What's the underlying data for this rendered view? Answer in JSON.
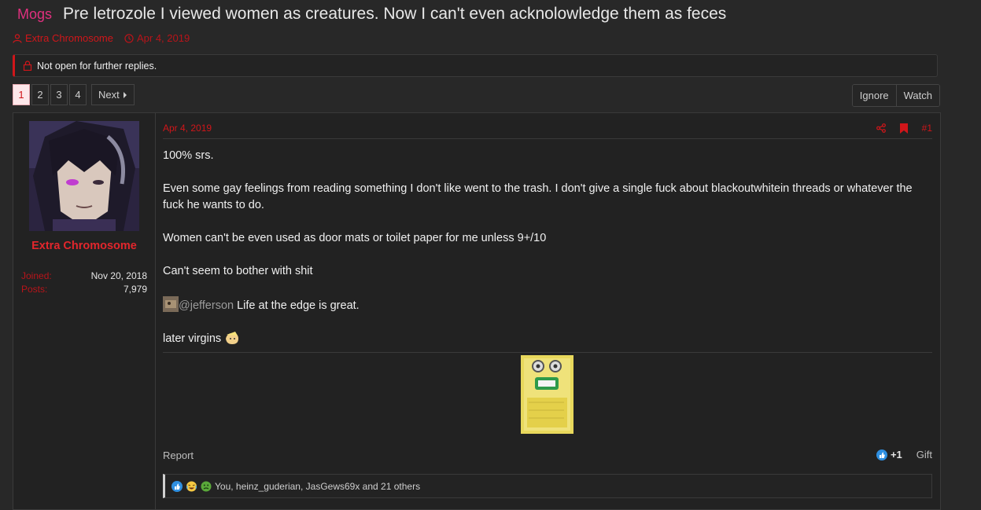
{
  "thread": {
    "prefix": "Mogs",
    "title": "Pre letrozole I viewed women as creatures. Now I can't even acknolowledge them as feces",
    "author": "Extra Chromosome",
    "date": "Apr 4, 2019"
  },
  "notice": {
    "text": "Not open for further replies."
  },
  "pagination": {
    "pages": [
      "1",
      "2",
      "3",
      "4"
    ],
    "current": "1",
    "next_label": "Next"
  },
  "thread_actions": {
    "ignore_label": "Ignore",
    "watch_label": "Watch"
  },
  "post": {
    "user": {
      "name": "Extra Chromosome",
      "joined_label": "Joined:",
      "joined_value": "Nov 20, 2018",
      "posts_label": "Posts:",
      "posts_value": "7,979"
    },
    "date": "Apr 4, 2019",
    "number": "#1",
    "body": {
      "p1": "100% srs.",
      "p2": "Even some gay feelings from reading something I don't like went to the trash. I don't give a single fuck about blackoutwhitein threads or whatever the fuck he wants to do.",
      "p3": "Women can't be even used as door mats or toilet paper for me unless 9+/10",
      "p4": "Can't seem to bother with shit",
      "mention": "@jefferson",
      "p5_rest": " Life at the edge is great.",
      "p6": "later virgins"
    },
    "report_label": "Report",
    "reaction_count": "+1",
    "gift_label": "Gift",
    "reactions_text": "You, heinz_guderian, JasGews69x and 21 others"
  },
  "colors": {
    "accent": "#d0161a",
    "prefix": "#e0307e",
    "background": "#282828"
  },
  "icons": [
    "user-icon",
    "clock-icon",
    "lock-icon",
    "chevron-right-icon",
    "share-icon",
    "bookmark-icon",
    "like-icon",
    "laugh-icon",
    "sick-icon"
  ]
}
